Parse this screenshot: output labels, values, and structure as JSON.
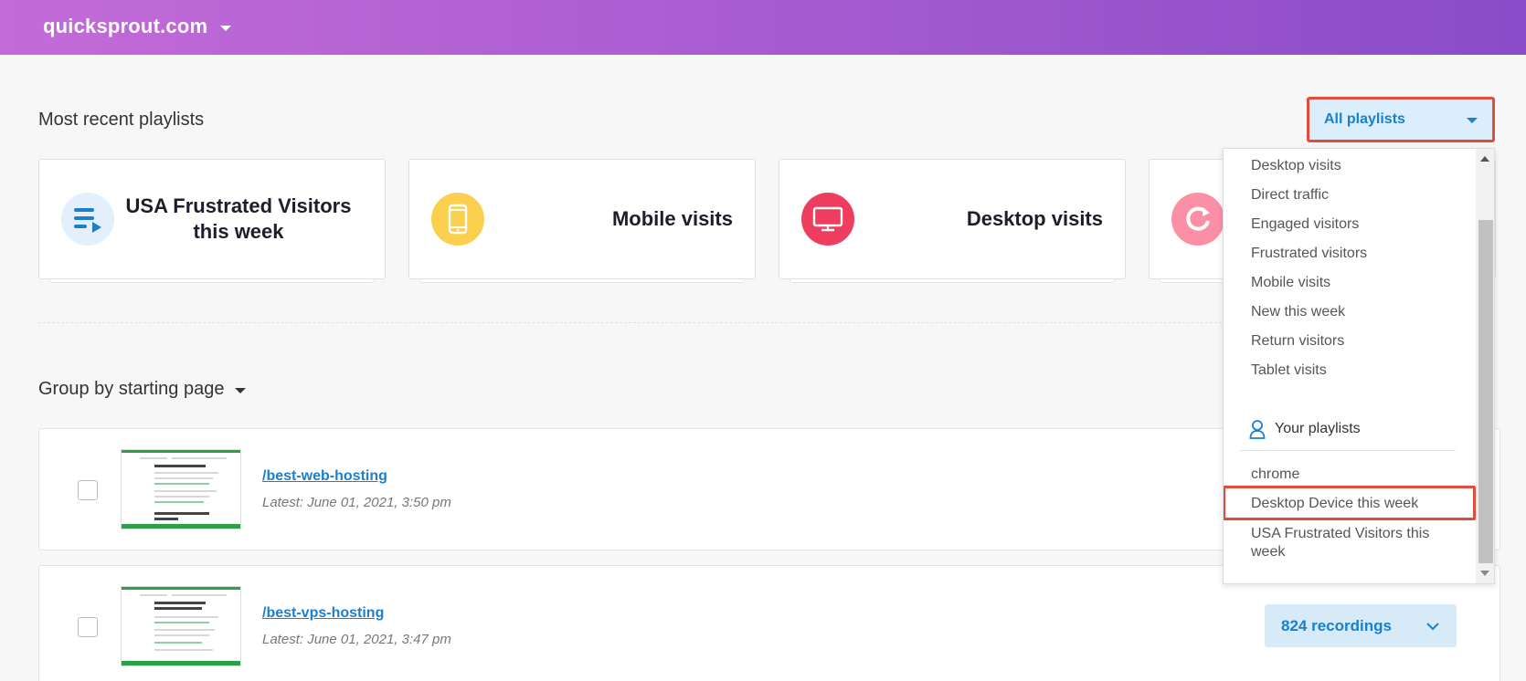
{
  "header": {
    "site_name": "quicksprout.com"
  },
  "recent": {
    "title": "Most recent playlists",
    "filter_label": "All playlists",
    "cards": [
      {
        "title": "USA Frustrated Visitors this week",
        "icon": "playlist-icon",
        "color": "#e3f0fb"
      },
      {
        "title": "Mobile visits",
        "icon": "mobile-icon",
        "color": "#fcd04f"
      },
      {
        "title": "Desktop visits",
        "icon": "desktop-icon",
        "color": "#ee3d5e"
      },
      {
        "title": "",
        "icon": "return-icon",
        "color": "#fb8fa6"
      }
    ]
  },
  "group": {
    "title": "Group by starting page",
    "rows": [
      {
        "path": "/best-web-hosting",
        "latest": "Latest: June 01, 2021, 3:50 pm"
      },
      {
        "path": "/best-vps-hosting",
        "latest": "Latest: June 01, 2021, 3:47 pm",
        "recordings_label": "824 recordings"
      }
    ]
  },
  "dropdown": {
    "items": [
      "Desktop visits",
      "Direct traffic",
      "Engaged visitors",
      "Frustrated visitors",
      "Mobile visits",
      "New this week",
      "Return visitors",
      "Tablet visits"
    ],
    "your_playlists_label": "Your playlists",
    "your_items": [
      "chrome",
      "Desktop Device this week",
      "USA Frustrated Visitors this week"
    ]
  }
}
